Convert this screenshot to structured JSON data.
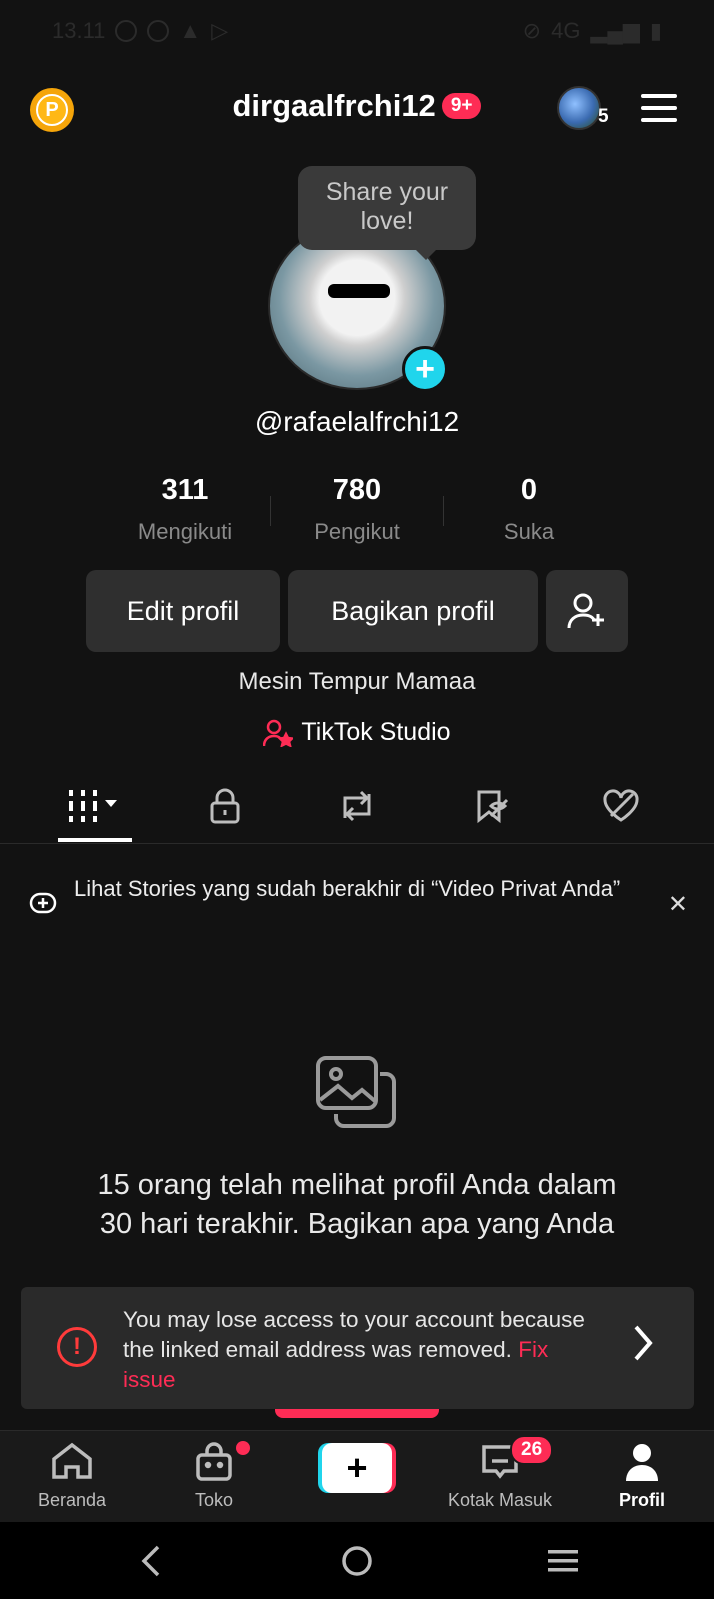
{
  "status_bar": {
    "time": "13.11",
    "network": "4G"
  },
  "header": {
    "username": "dirgaalfrchi12",
    "notification_badge": "9+",
    "account_switch_count": "5"
  },
  "profile": {
    "tooltip": "Share your love!",
    "handle": "@rafaelalfrchi12",
    "bio": "Mesin Tempur Mamaa",
    "studio_link": "TikTok Studio"
  },
  "stats": [
    {
      "value": "311",
      "label": "Mengikuti"
    },
    {
      "value": "780",
      "label": "Pengikut"
    },
    {
      "value": "0",
      "label": "Suka"
    }
  ],
  "buttons": {
    "edit": "Edit profil",
    "share": "Bagikan profil"
  },
  "tabs": [
    {
      "icon": "videos-grid-icon",
      "active": true
    },
    {
      "icon": "lock-icon"
    },
    {
      "icon": "repost-icon"
    },
    {
      "icon": "bookmark-hidden-icon"
    },
    {
      "icon": "liked-hidden-icon"
    }
  ],
  "stories_banner": {
    "text": "Lihat Stories yang sudah berakhir di “Video Privat Anda”"
  },
  "empty_state": {
    "text": "15 orang telah melihat profil Anda dalam 30 hari terakhir. Bagikan apa yang Anda"
  },
  "alert": {
    "message": "You may lose access to your account because the linked email address was removed.",
    "action": "Fix issue"
  },
  "bottom_nav": [
    {
      "label": "Beranda",
      "icon": "home-icon"
    },
    {
      "label": "Toko",
      "icon": "shop-icon"
    },
    {
      "label": "",
      "icon": "create-icon"
    },
    {
      "label": "Kotak Masuk",
      "icon": "inbox-icon",
      "badge": "26"
    },
    {
      "label": "Profil",
      "icon": "profile-icon",
      "active": true
    }
  ],
  "colors": {
    "accent": "#fe2c55",
    "cyan": "#20d5ec",
    "background": "#121212"
  }
}
